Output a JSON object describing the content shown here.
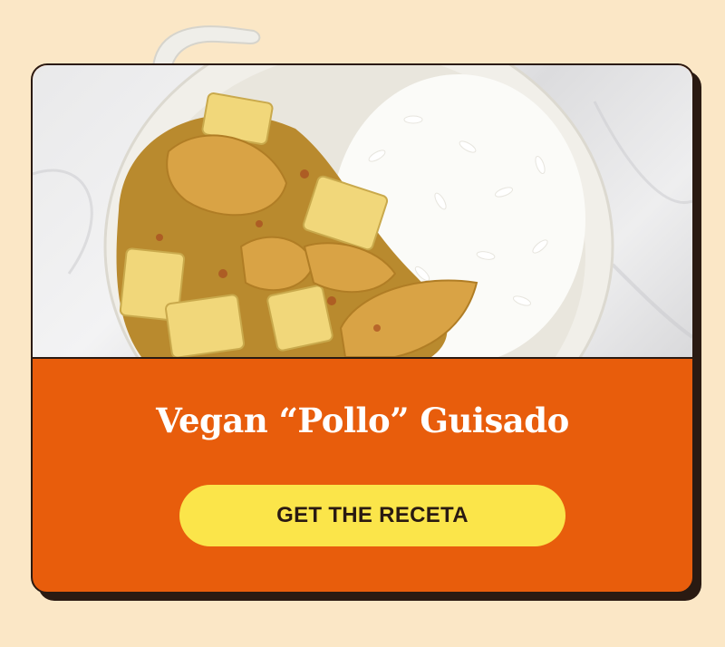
{
  "card": {
    "title": "Vegan “Pollo” Guisado",
    "cta_label": "GET THE RECETA"
  },
  "colors": {
    "page_background": "#fbe7c6",
    "card_background": "#e85d0c",
    "button_background": "#fbe54a",
    "outline": "#2a1a12",
    "title_text": "#ffffff"
  },
  "image": {
    "subject": "bowl of stew with potatoes beside white rice on marble surface"
  }
}
